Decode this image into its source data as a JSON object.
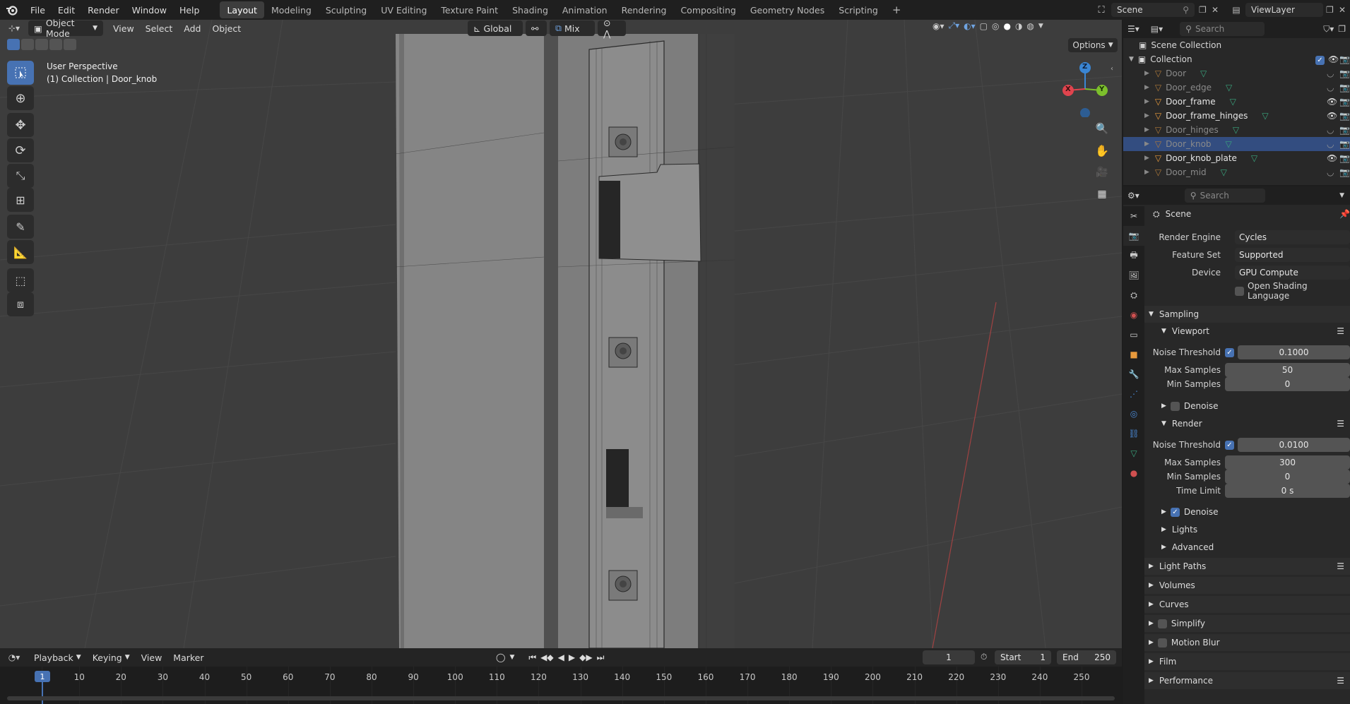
{
  "topbar": {
    "menus": [
      "File",
      "Edit",
      "Render",
      "Window",
      "Help"
    ],
    "workspaces": [
      "Layout",
      "Modeling",
      "Sculpting",
      "UV Editing",
      "Texture Paint",
      "Shading",
      "Animation",
      "Rendering",
      "Compositing",
      "Geometry Nodes",
      "Scripting"
    ],
    "active_workspace": "Layout",
    "add_tab": "+",
    "scene": "Scene",
    "view_layer": "ViewLayer"
  },
  "viewport_header": {
    "mode": "Object Mode",
    "menus": [
      "View",
      "Select",
      "Add",
      "Object"
    ],
    "transform_orientation": "Global",
    "snap_mode": "Mix",
    "options": "Options"
  },
  "viewport": {
    "perspective": "User Perspective",
    "context": "(1) Collection | Door_knob",
    "gizmo_axes": {
      "x": "X",
      "y": "Y",
      "z": "Z"
    },
    "axis_colors": {
      "x": "#e0444e",
      "y": "#7cbf2c",
      "z": "#3a86d4"
    }
  },
  "outliner": {
    "search_placeholder": "Search",
    "root": "Scene Collection",
    "collection": "Collection",
    "items": [
      {
        "name": "Door",
        "visible": false
      },
      {
        "name": "Door_edge",
        "visible": false
      },
      {
        "name": "Door_frame",
        "visible": true
      },
      {
        "name": "Door_frame_hinges",
        "visible": true
      },
      {
        "name": "Door_hinges",
        "visible": false
      },
      {
        "name": "Door_knob",
        "visible": false,
        "selected": true
      },
      {
        "name": "Door_knob_plate",
        "visible": true
      },
      {
        "name": "Door_mid",
        "visible": false
      }
    ]
  },
  "properties": {
    "search_placeholder": "Search",
    "context": "Scene",
    "render_engine": {
      "label": "Render Engine",
      "value": "Cycles"
    },
    "feature_set": {
      "label": "Feature Set",
      "value": "Supported"
    },
    "device": {
      "label": "Device",
      "value": "GPU Compute"
    },
    "osl": "Open Shading Language",
    "sampling": "Sampling",
    "viewport": {
      "title": "Viewport",
      "noise_threshold_label": "Noise Threshold",
      "noise_threshold": "0.1000",
      "max_samples_label": "Max Samples",
      "max_samples": "50",
      "min_samples_label": "Min Samples",
      "min_samples": "0",
      "denoise": "Denoise"
    },
    "render": {
      "title": "Render",
      "noise_threshold_label": "Noise Threshold",
      "noise_threshold": "0.0100",
      "max_samples_label": "Max Samples",
      "max_samples": "300",
      "min_samples_label": "Min Samples",
      "min_samples": "0",
      "time_limit_label": "Time Limit",
      "time_limit": "0 s",
      "denoise": "Denoise"
    },
    "lights": "Lights",
    "advanced": "Advanced",
    "panels": [
      "Light Paths",
      "Volumes",
      "Curves",
      "Simplify",
      "Motion Blur",
      "Film",
      "Performance"
    ]
  },
  "timeline": {
    "menus": [
      "Playback",
      "Keying",
      "View",
      "Marker"
    ],
    "current_frame": "1",
    "start_label": "Start",
    "start": "1",
    "end_label": "End",
    "end": "250",
    "ticks": [
      "1",
      "10",
      "20",
      "30",
      "40",
      "50",
      "60",
      "70",
      "80",
      "90",
      "100",
      "110",
      "120",
      "130",
      "140",
      "150",
      "160",
      "170",
      "180",
      "190",
      "200",
      "210",
      "220",
      "230",
      "240",
      "250"
    ]
  }
}
